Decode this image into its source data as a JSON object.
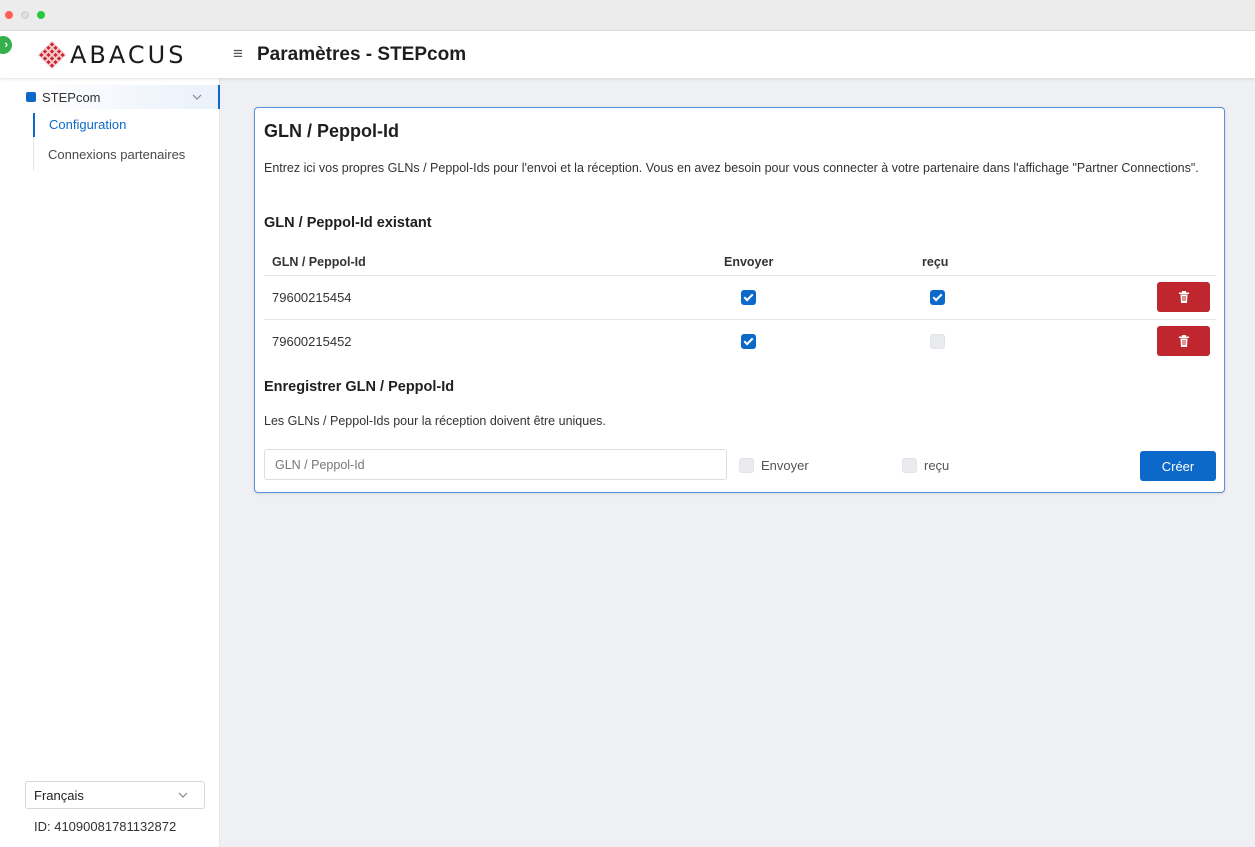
{
  "app": {
    "logo_text": "ABACUS",
    "page_title": "Paramètres - STEPcom"
  },
  "sidebar": {
    "group": {
      "label": "STEPcom"
    },
    "items": [
      {
        "label": "Configuration",
        "active": true
      },
      {
        "label": "Connexions partenaires",
        "active": false
      }
    ],
    "language": {
      "value": "Français"
    },
    "session_id": "ID: 41090081781132872"
  },
  "card": {
    "title": "GLN / Peppol-Id",
    "description": "Entrez ici vos propres GLNs / Peppol-Ids pour l'envoi et la réception. Vous en avez besoin pour vous connecter à votre partenaire dans l'affichage \"Partner Connections\".",
    "existing_heading": "GLN / Peppol-Id existant",
    "table": {
      "headers": [
        "GLN / Peppol-Id",
        "Envoyer",
        "reçu"
      ],
      "rows": [
        {
          "id": "79600215454",
          "send": true,
          "receive": true
        },
        {
          "id": "79600215452",
          "send": true,
          "receive": false
        }
      ]
    },
    "register_heading": "Enregistrer GLN / Peppol-Id",
    "register_hint": "Les GLNs / Peppol-Ids pour la réception doivent être uniques.",
    "form": {
      "input_placeholder": "GLN / Peppol-Id",
      "input_value": "",
      "send_label": "Envoyer",
      "send_checked": false,
      "receive_label": "reçu",
      "receive_checked": false,
      "create_label": "Créer"
    }
  },
  "colors": {
    "accent": "#0c69c9",
    "danger": "#c0262d",
    "card_border": "#5b8fd6",
    "background": "#eff0f3"
  }
}
